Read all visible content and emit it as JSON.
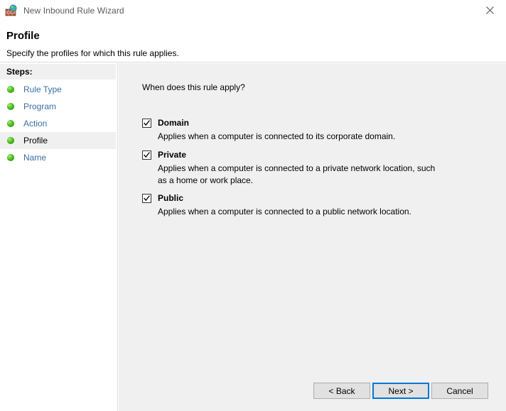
{
  "window": {
    "title": "New Inbound Rule Wizard",
    "icon": "firewall-globe-icon",
    "close_label": "✕"
  },
  "header": {
    "title": "Profile",
    "subtitle": "Specify the profiles for which this rule applies."
  },
  "sidebar": {
    "heading": "Steps:",
    "items": [
      {
        "label": "Rule Type",
        "current": false
      },
      {
        "label": "Program",
        "current": false
      },
      {
        "label": "Action",
        "current": false
      },
      {
        "label": "Profile",
        "current": true
      },
      {
        "label": "Name",
        "current": false
      }
    ]
  },
  "main": {
    "question": "When does this rule apply?",
    "options": [
      {
        "label": "Domain",
        "description": "Applies when a computer is connected to its corporate domain.",
        "checked": true
      },
      {
        "label": "Private",
        "description": "Applies when a computer is connected to a private network location, such as a home or work place.",
        "checked": true
      },
      {
        "label": "Public",
        "description": "Applies when a computer is connected to a public network location.",
        "checked": true
      }
    ]
  },
  "buttons": {
    "back": "< Back",
    "next": "Next >",
    "cancel": "Cancel"
  },
  "colors": {
    "accent": "#0078d7",
    "link": "#3a6ea5",
    "pane_background": "#f0f0f0",
    "bullet_green": "#4fc21a"
  }
}
